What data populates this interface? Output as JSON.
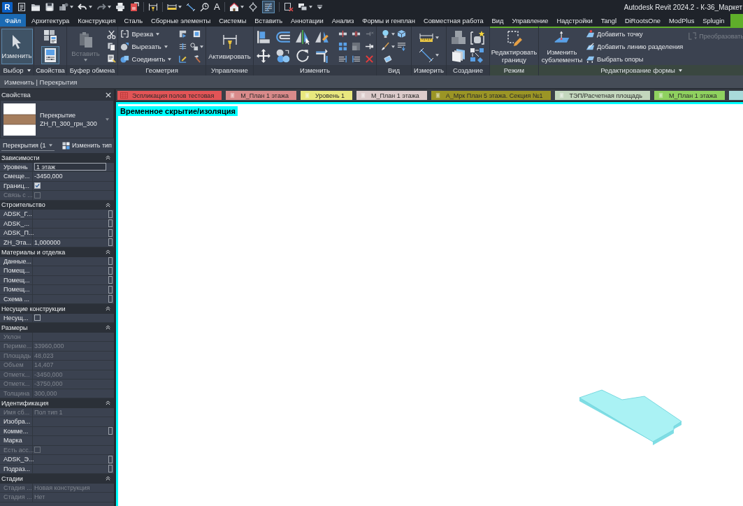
{
  "title_bar": {
    "logo": "R",
    "text_tool": "A",
    "thin_lines": {
      "on": true
    },
    "title": "Autodesk Revit 2024.2 - К-36_Маркет"
  },
  "tabs": [
    {
      "label": "Файл",
      "kind": "file",
      "selected": false
    },
    {
      "label": "Архитектура",
      "kind": "normal",
      "selected": false
    },
    {
      "label": "Конструкция",
      "kind": "normal",
      "selected": false
    },
    {
      "label": "Сталь",
      "kind": "normal",
      "selected": false
    },
    {
      "label": "Сборные элементы",
      "kind": "normal",
      "selected": false
    },
    {
      "label": "Системы",
      "kind": "normal",
      "selected": false
    },
    {
      "label": "Вставить",
      "kind": "normal",
      "selected": false
    },
    {
      "label": "Аннотации",
      "kind": "normal",
      "selected": false
    },
    {
      "label": "Анализ",
      "kind": "normal",
      "selected": false
    },
    {
      "label": "Формы и генплан",
      "kind": "normal",
      "selected": false
    },
    {
      "label": "Совместная работа",
      "kind": "normal",
      "selected": false
    },
    {
      "label": "Вид",
      "kind": "normal",
      "selected": false
    },
    {
      "label": "Управление",
      "kind": "normal",
      "selected": false
    },
    {
      "label": "Надстройки",
      "kind": "normal",
      "selected": false
    },
    {
      "label": "Tangl",
      "kind": "normal",
      "selected": false
    },
    {
      "label": "DiRootsOne",
      "kind": "normal",
      "selected": false
    },
    {
      "label": "ModPlus",
      "kind": "normal",
      "selected": false
    },
    {
      "label": "Splugin",
      "kind": "normal",
      "selected": false
    },
    {
      "kind": "contextual",
      "selected": true
    }
  ],
  "ribbon": {
    "panels": [
      {
        "kind": "select",
        "title": "Выбор",
        "menu": true,
        "contextual": false,
        "modify_button": {
          "label": "Изменить",
          "selected": true
        }
      },
      {
        "kind": "properties",
        "title": "Свойства",
        "menu": false,
        "contextual": false,
        "palette_toggle": {
          "on": true
        }
      },
      {
        "kind": "clipboard",
        "title": "Буфер обмена",
        "menu": false,
        "contextual": false,
        "paste_button": {
          "label": "Вставить",
          "disabled": true
        }
      },
      {
        "kind": "geometry",
        "title": "Геометрия",
        "menu": false,
        "contextual": false,
        "buttons": [
          {
            "label": "Врезка",
            "dropdown": true
          },
          {
            "label": "Вырезать",
            "dropdown": true
          },
          {
            "label": "Соединить",
            "dropdown": true
          }
        ]
      },
      {
        "kind": "control",
        "title": "Управление",
        "menu": false,
        "contextual": false,
        "activate_button": {
          "label": "Активировать"
        }
      },
      {
        "kind": "modify",
        "title": "Изменить",
        "menu": false,
        "contextual": false
      },
      {
        "kind": "view",
        "title": "Вид",
        "menu": false,
        "contextual": false
      },
      {
        "kind": "measure",
        "title": "Измерить",
        "menu": false,
        "contextual": false
      },
      {
        "kind": "create",
        "title": "Создание",
        "menu": false,
        "contextual": false
      },
      {
        "kind": "mode",
        "title": "Режим",
        "menu": false,
        "contextual": true,
        "edit_boundary_button": {
          "label": "Редактировать границу"
        }
      },
      {
        "kind": "shape_editing",
        "title": "Редактирование формы",
        "menu": true,
        "contextual": true,
        "sub_elements_button": {
          "label": "Изменить субэлементы"
        },
        "buttons": [
          {
            "label": "Добавить точку",
            "disabled": false
          },
          {
            "label": "Добавить линию разделения",
            "disabled": false
          },
          {
            "label": "Выбрать опоры",
            "disabled": false
          }
        ],
        "convert_button": {
          "label": "Преобразовать",
          "disabled": true
        }
      }
    ]
  },
  "context_bar": {
    "text": "Изменить | Перекрытия"
  },
  "properties": {
    "title": "Свойства",
    "type": {
      "family": "Перекрытие",
      "name": "ZH_П_300_грн_300"
    },
    "filter": "Перекрытия (1",
    "edit_type_button": "Изменить тип",
    "groups": [
      {
        "name": "Зависимости",
        "expanded": true,
        "rows": [
          {
            "label": "Уровень",
            "kind": "field",
            "value": "1 этаж",
            "disabled": false
          },
          {
            "label": "Смеще...",
            "kind": "text",
            "value": "-3450,000",
            "disabled": false
          },
          {
            "label": "Границ...",
            "kind": "checkbox",
            "checked": true,
            "disabled": false
          },
          {
            "label": "Связь с ...",
            "kind": "checkbox",
            "checked": false,
            "disabled": true
          }
        ]
      },
      {
        "name": "Строительство",
        "expanded": true,
        "rows": [
          {
            "label": "ADSK_Г...",
            "kind": "text",
            "disabled": false,
            "param_button": true
          },
          {
            "label": "ADSK_...",
            "kind": "text",
            "disabled": false,
            "param_button": true
          },
          {
            "label": "ADSK_П...",
            "kind": "text",
            "disabled": false,
            "param_button": true
          },
          {
            "label": "ZH_Эта...",
            "kind": "text",
            "value": "1,000000",
            "disabled": false,
            "param_button": true
          }
        ]
      },
      {
        "name": "Материалы и отделка",
        "expanded": true,
        "rows": [
          {
            "label": "Данные...",
            "kind": "text",
            "disabled": false,
            "param_button": true
          },
          {
            "label": "Помещ...",
            "kind": "text",
            "disabled": false,
            "param_button": true
          },
          {
            "label": "Помещ...",
            "kind": "text",
            "disabled": false,
            "param_button": true
          },
          {
            "label": "Помещ...",
            "kind": "text",
            "disabled": false,
            "param_button": true
          },
          {
            "label": "Схема ...",
            "kind": "text",
            "disabled": false,
            "param_button": true
          }
        ]
      },
      {
        "name": "Несущие конструкции",
        "expanded": true,
        "rows": [
          {
            "label": "Несущ...",
            "kind": "checkbox",
            "checked": false,
            "disabled": false
          }
        ]
      },
      {
        "name": "Размеры",
        "expanded": true,
        "rows": [
          {
            "label": "Уклон",
            "kind": "text",
            "disabled": true
          },
          {
            "label": "Периме...",
            "kind": "text",
            "value": "33960,000",
            "disabled": true
          },
          {
            "label": "Площадь",
            "kind": "text",
            "value": "48,023",
            "disabled": true
          },
          {
            "label": "Объем",
            "kind": "text",
            "value": "14,407",
            "disabled": true
          },
          {
            "label": "Отметк...",
            "kind": "text",
            "value": "-3450,000",
            "disabled": true
          },
          {
            "label": "Отметк...",
            "kind": "text",
            "value": "-3750,000",
            "disabled": true
          },
          {
            "label": "Толщина",
            "kind": "text",
            "value": "300,000",
            "disabled": true
          }
        ]
      },
      {
        "name": "Идентификация",
        "expanded": true,
        "rows": [
          {
            "label": "Имя сб...",
            "kind": "text",
            "value": "Пол тип 1",
            "disabled": true
          },
          {
            "label": "Изобра...",
            "kind": "text",
            "disabled": false
          },
          {
            "label": "Комме...",
            "kind": "text",
            "disabled": false,
            "param_button": true
          },
          {
            "label": "Марка",
            "kind": "text",
            "disabled": false
          },
          {
            "label": "Есть асс...",
            "kind": "checkbox",
            "checked": false,
            "disabled": true
          },
          {
            "label": "ADSK_Э...",
            "kind": "text",
            "disabled": false,
            "param_button": true
          },
          {
            "label": "Подраз...",
            "kind": "text",
            "disabled": false,
            "param_button": true
          }
        ]
      },
      {
        "name": "Стадии",
        "expanded": true,
        "rows": [
          {
            "label": "Стадия ...",
            "kind": "text",
            "value": "Новая конструкция",
            "disabled": true
          },
          {
            "label": "Стадия ...",
            "kind": "text",
            "value": "Нет",
            "disabled": true
          }
        ]
      }
    ]
  },
  "view_tabs": [
    {
      "label": "Эспликация полов тестовая",
      "kind": "schedule",
      "color": "#e25456"
    },
    {
      "label": "М_План 1 этажа",
      "kind": "plan",
      "color": "#d98a8a"
    },
    {
      "label": "Уровень 1",
      "kind": "plan",
      "color": "#e9e87e"
    },
    {
      "label": "М_План 1 этажа",
      "kind": "plan",
      "color": "#dccbcb"
    },
    {
      "label": "А_Мрк План 5 этажа. Секция №1",
      "kind": "plan",
      "color": "#9b9525"
    },
    {
      "label": "ТЭП/Расчетная площадь",
      "kind": "plan",
      "color": "#c3d7bd"
    },
    {
      "label": "М_План 1 этажа",
      "kind": "plan",
      "color": "#8fd15f"
    },
    {
      "color": "#a9dada"
    }
  ],
  "canvas": {
    "isolation_label": "Временное скрытие/изоляция"
  }
}
